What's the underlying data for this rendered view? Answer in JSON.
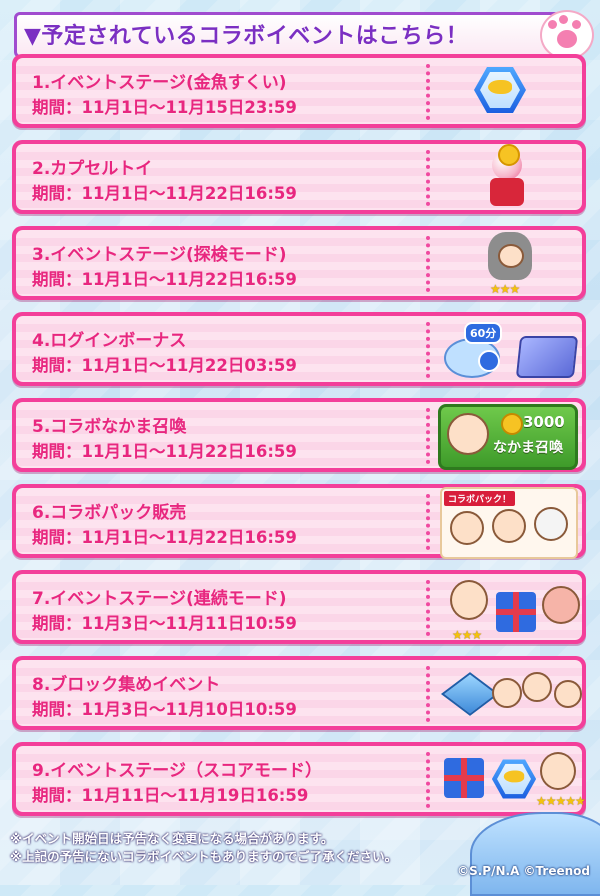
{
  "header": {
    "title": "▼予定されているコラボイベントはこちら！",
    "accent_color": "#7b2fc2"
  },
  "events": [
    {
      "title": "1.イベントステージ(金魚すくい)",
      "period": "期間：11月1日〜11月15日23:59",
      "icon": "goldfish-medal-icon"
    },
    {
      "title": "2.カプセルトイ",
      "period": "期間：11月1日〜11月22日16:59",
      "icon": "gachapon-machine-icon"
    },
    {
      "title": "3.イベントステージ(探検モード)",
      "period": "期間：11月1日〜11月22日16:59",
      "icon": "cat-costume-character-icon",
      "stars": "★★★"
    },
    {
      "title": "4.ログインボーナス",
      "period": "期間：11月1日〜11月22日03:59",
      "icon": "time-boost-ticket-icon",
      "badge": "60分"
    },
    {
      "title": "5.コラボなかま召喚",
      "period": "期間：11月1日〜11月22日16:59",
      "icon": "summon-button-icon",
      "summon_count": "3000",
      "summon_label": "なかま召喚"
    },
    {
      "title": "6.コラボパック販売",
      "period": "期間：11月1日〜11月22日16:59",
      "icon": "collab-pack-icon",
      "pack_label": "コラボパック！"
    },
    {
      "title": "7.イベントステージ(連続モード)",
      "period": "期間：11月3日〜11月11日10:59",
      "icon": "gift-and-characters-icon",
      "stars": "★★★"
    },
    {
      "title": "8.ブロック集めイベント",
      "period": "期間：11月3日〜11月10日10:59",
      "icon": "block-and-characters-icon"
    },
    {
      "title": "9.イベントステージ（スコアモード）",
      "period": "期間：11月11日〜11月19日16:59",
      "icon": "gift-medal-character-icon",
      "stars": "★★★★★"
    }
  ],
  "notes": [
    "※イベント開始日は予告なく変更になる場合があります。",
    "※上記の予告にないコラボイベントもありますのでご了承ください。"
  ],
  "copyright": "©S.P/N.A ©Treenod",
  "colors": {
    "card_border": "#f33f9a",
    "card_text": "#e8277f"
  }
}
